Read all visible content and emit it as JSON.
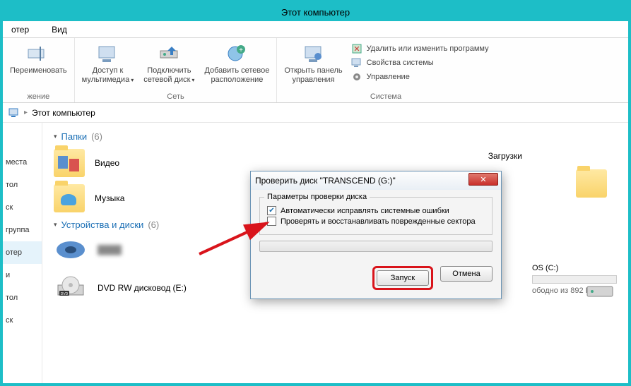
{
  "titlebar": {
    "title": "Этот компьютер"
  },
  "tabs": {
    "tab1": "отер",
    "tab2": "Вид"
  },
  "ribbon": {
    "rename": "Переименовать",
    "media_access1": "Доступ к",
    "media_access2": "мультимедиа",
    "map_drive1": "Подключить",
    "map_drive2": "сетевой диск",
    "add_net1": "Добавить сетевое",
    "add_net2": "расположение",
    "open_panel1": "Открыть панель",
    "open_panel2": "управления",
    "uninstall": "Удалить или изменить программу",
    "sys_props": "Свойства системы",
    "manage": "Управление",
    "group_location": "жение",
    "group_network": "Сеть",
    "group_system": "Система"
  },
  "breadcrumb": {
    "root": "Этот компьютер"
  },
  "sidebar": {
    "items": [
      "места",
      "тол",
      "ск",
      "группа",
      "отер",
      "и",
      "тол",
      "ск"
    ]
  },
  "content": {
    "folders_header": "Папки",
    "folders_count": "(6)",
    "folder_video": "Видео",
    "folder_downloads": "Загрузки",
    "folder_music": "Музыка",
    "devices_header": "Устройства и диски",
    "devices_count": "(6)",
    "dvd_label": "DVD RW дисковод (E:)",
    "disk_c_label": "OS (C:)",
    "disk_c_free": "ободно из 892 ГБ"
  },
  "dialog": {
    "title": "Проверить диск \"TRANSCEND (G:)\"",
    "group_label": "Параметры проверки диска",
    "opt_fix": "Автоматически исправлять системные ошибки",
    "opt_scan": "Проверять и восстанавливать поврежденные сектора",
    "btn_start": "Запуск",
    "btn_cancel": "Отмена"
  }
}
